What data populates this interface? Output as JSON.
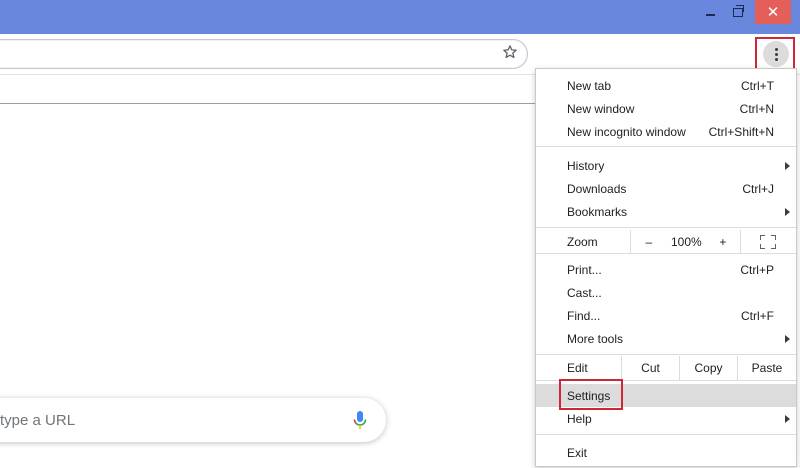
{
  "window": {
    "minimize_icon": "minimize-icon",
    "maximize_icon": "restore-icon",
    "close_label": "✕",
    "titlebar_color": "#6a87de",
    "close_color": "#e45f5a"
  },
  "toolbar": {
    "bookmark_icon": "star-icon",
    "menu_icon": "three-dot-menu-icon",
    "highlight_color": "#cf2733"
  },
  "page": {
    "search_placeholder": "type a URL",
    "mic_icon": "microphone-icon"
  },
  "menu": {
    "new_tab": {
      "label": "New tab",
      "shortcut": "Ctrl+T"
    },
    "new_window": {
      "label": "New window",
      "shortcut": "Ctrl+N"
    },
    "new_incognito": {
      "label": "New incognito window",
      "shortcut": "Ctrl+Shift+N"
    },
    "history": {
      "label": "History"
    },
    "downloads": {
      "label": "Downloads",
      "shortcut": "Ctrl+J"
    },
    "bookmarks": {
      "label": "Bookmarks"
    },
    "zoom": {
      "label": "Zoom",
      "minus": "–",
      "value": "100%",
      "plus": "+"
    },
    "print": {
      "label": "Print...",
      "shortcut": "Ctrl+P"
    },
    "cast": {
      "label": "Cast..."
    },
    "find": {
      "label": "Find...",
      "shortcut": "Ctrl+F"
    },
    "more_tools": {
      "label": "More tools"
    },
    "edit": {
      "label": "Edit",
      "cut": "Cut",
      "copy": "Copy",
      "paste": "Paste"
    },
    "settings": {
      "label": "Settings"
    },
    "help": {
      "label": "Help"
    },
    "exit": {
      "label": "Exit"
    }
  }
}
